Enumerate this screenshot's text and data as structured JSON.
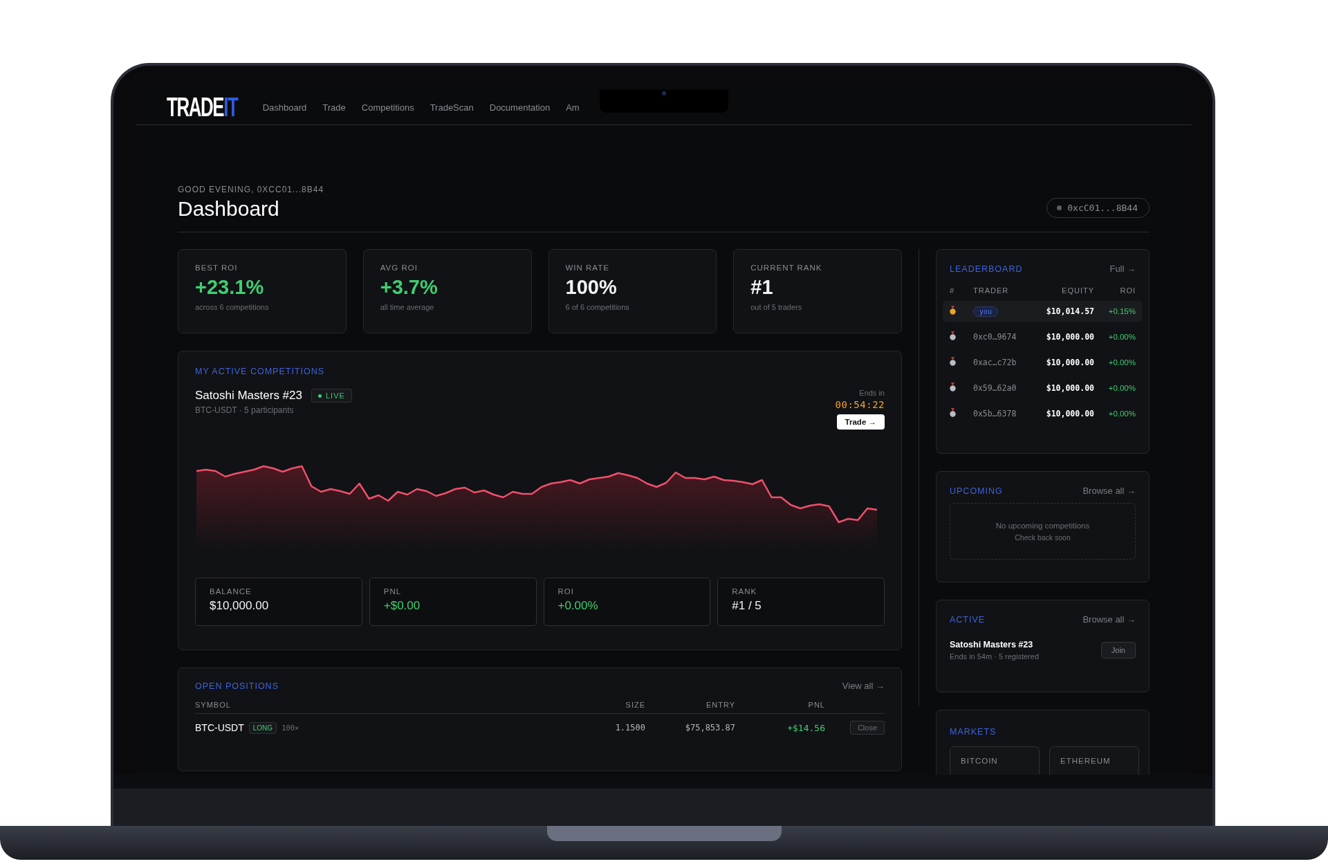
{
  "brand": {
    "name_main": "TRADE",
    "name_accent": "IT"
  },
  "nav": [
    "Dashboard",
    "Trade",
    "Competitions",
    "TradeScan",
    "Documentation",
    "Am"
  ],
  "header": {
    "greeting": "GOOD EVENING, 0XCC01...8B44",
    "title": "Dashboard",
    "wallet": "0xcC01...8B44"
  },
  "stats": [
    {
      "label": "BEST ROI",
      "value": "+23.1%",
      "note": "across 6 competitions",
      "kind": "positive"
    },
    {
      "label": "AVG ROI",
      "value": "+3.7%",
      "note": "all time average",
      "kind": "positive"
    },
    {
      "label": "WIN RATE",
      "value": "100%",
      "note": "6 of 6 competitions",
      "kind": "neutral"
    },
    {
      "label": "CURRENT RANK",
      "value": "#1",
      "note": "out of 5 traders",
      "kind": "neutral"
    }
  ],
  "active_competitions": {
    "heading": "MY ACTIVE COMPETITIONS",
    "name": "Satoshi Masters #23",
    "status": "LIVE",
    "meta": "BTC-USDT · 5 participants",
    "ends_label": "Ends in",
    "countdown": "00:54:22",
    "trade_button": "Trade →",
    "metrics": [
      {
        "label": "BALANCE",
        "value": "$10,000.00",
        "kind": "neutral"
      },
      {
        "label": "PNL",
        "value": "+$0.00",
        "kind": "positive"
      },
      {
        "label": "ROI",
        "value": "+0.00%",
        "kind": "positive"
      },
      {
        "label": "RANK",
        "value": "#1 / 5",
        "kind": "neutral"
      }
    ]
  },
  "open_positions": {
    "heading": "OPEN POSITIONS",
    "link": "View all →",
    "columns": [
      "SYMBOL",
      "SIZE",
      "ENTRY",
      "PNL"
    ],
    "rows": [
      {
        "symbol": "BTC-USDT",
        "side": "LONG",
        "leverage": "100×",
        "size": "1.1500",
        "entry": "$75,853.87",
        "pnl": "+$14.56",
        "action": "Close"
      }
    ]
  },
  "leaderboard": {
    "heading": "LEADERBOARD",
    "link": "Full →",
    "columns": [
      "#",
      "TRADER",
      "EQUITY",
      "ROI"
    ],
    "rows": [
      {
        "trader": "you",
        "current_user": true,
        "color": "#e8a628",
        "equity": "$10,014.57",
        "roi": "+0.15%"
      },
      {
        "trader": "0xc0…9674",
        "current_user": false,
        "color": "#b9bcc2",
        "equity": "$10,000.00",
        "roi": "+0.00%"
      },
      {
        "trader": "0xac…c72b",
        "current_user": false,
        "color": "#b9bcc2",
        "equity": "$10,000.00",
        "roi": "+0.00%"
      },
      {
        "trader": "0x59…62a0",
        "current_user": false,
        "color": "#b9bcc2",
        "equity": "$10,000.00",
        "roi": "+0.00%"
      },
      {
        "trader": "0x5b…6378",
        "current_user": false,
        "color": "#b9bcc2",
        "equity": "$10,000.00",
        "roi": "+0.00%"
      }
    ]
  },
  "upcoming": {
    "heading": "UPCOMING",
    "link": "Browse all →",
    "empty_title": "No upcoming competitions",
    "empty_note": "Check back soon"
  },
  "active": {
    "heading": "ACTIVE",
    "link": "Browse all →",
    "items": [
      {
        "name": "Satoshi Masters #23",
        "meta": "Ends in 54m · 5 registered",
        "action": "Join"
      }
    ]
  },
  "markets": {
    "heading": "MARKETS",
    "items": [
      "BITCOIN",
      "ETHEREUM"
    ]
  }
}
